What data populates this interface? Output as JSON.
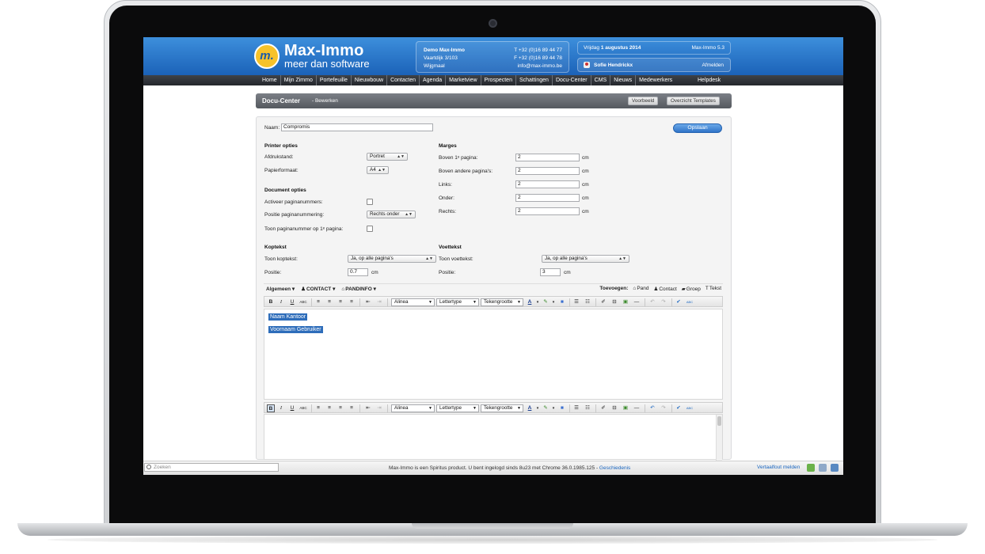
{
  "header": {
    "logo_mark": "m.",
    "logo_title": "Max-Immo",
    "logo_subtitle": "meer dan software",
    "office": {
      "name": "Demo Max-Immo",
      "street": "Vaartdijk 3/103",
      "city": "Wijgmaal",
      "phone": "T +32 (0)16 89 44 77",
      "fax": "F +32 (0)16 89 44 78",
      "email": "info@max-immo.be"
    },
    "date_prefix": "Vrijdag",
    "date_value": "1 augustus 2014",
    "version": "Max-Immo 5.3",
    "user_name": "Sofie Hendrickx",
    "logout_label": "Afmelden"
  },
  "nav": {
    "items": [
      "Home",
      "Mijn Zimmo",
      "Portefeuille",
      "Nieuwbouw",
      "Contacten",
      "Agenda",
      "Marketview",
      "Prospecten",
      "Schattingen",
      "Docu-Center",
      "CMS",
      "Nieuws",
      "Medewerkers"
    ],
    "help": "Helpdesk"
  },
  "titlebar": {
    "title": "Docu-Center",
    "subtitle": "- Bewerken",
    "preview_label": "Voorbeeld",
    "overview_label": "Overzicht Templates"
  },
  "form": {
    "name_label": "Naam:",
    "name_value": "Compromis",
    "save_label": "Opslaan",
    "printer": {
      "heading": "Printer opties",
      "orientation_label": "Afdrukstand:",
      "orientation_value": "Portret",
      "paper_label": "Papierformaat:",
      "paper_value": "A4"
    },
    "document": {
      "heading": "Document opties",
      "activate_label": "Activeer paginanummers:",
      "position_label": "Positie paginanummering:",
      "position_value": "Rechts onder",
      "first_page_label": "Toon paginanummer op 1ᵉ pagina:"
    },
    "margins": {
      "heading": "Marges",
      "unit": "cm",
      "rows": [
        {
          "label": "Boven 1ᵉ pagina:",
          "value": "2"
        },
        {
          "label": "Boven andere pagina's:",
          "value": "2"
        },
        {
          "label": "Links:",
          "value": "2"
        },
        {
          "label": "Onder:",
          "value": "2"
        },
        {
          "label": "Rechts:",
          "value": "2"
        }
      ]
    },
    "header_text": {
      "heading": "Koptekst",
      "show_label": "Toon koptekst:",
      "show_value": "Ja, op alle pagina's",
      "position_label": "Positie:",
      "position_value": "0.7",
      "unit": "cm"
    },
    "footer_text": {
      "heading": "Voettekst",
      "show_label": "Toon voettekst:",
      "show_value": "Ja, op alle pagina's",
      "position_label": "Positie:",
      "position_value": "3",
      "unit": "cm"
    }
  },
  "insert_bar": {
    "menus": [
      "Algemeen",
      "CONTACT",
      "PANDINFO"
    ],
    "add_label": "Toevoegen:",
    "add_items": [
      "Pand",
      "Contact",
      "Groep",
      "Tekst"
    ]
  },
  "toolbar": {
    "bold": "B",
    "italic": "I",
    "underline": "U",
    "strike": "ABC",
    "paragraph": "Alinea",
    "font": "Lettertype",
    "size": "Tekengrootte",
    "text_color_glyph": "A",
    "spell_label": "ABC"
  },
  "editor": {
    "tags": [
      "Naam Kantoor",
      "Voornaam Gebruiker"
    ]
  },
  "statusbar": {
    "search_placeholder": "Zoeken",
    "text": "Max-Immo is een Spiritus product. U bent ingelogd sinds 8u23 met Chrome 36.0.1985.125 - ",
    "history_link": "Geschiedenis",
    "report_link": "Vertaalfout melden"
  },
  "colors": {
    "header_blue": "#1b62b8",
    "logo_yellow": "#f7c22a",
    "tag_blue": "#2e6dba"
  }
}
